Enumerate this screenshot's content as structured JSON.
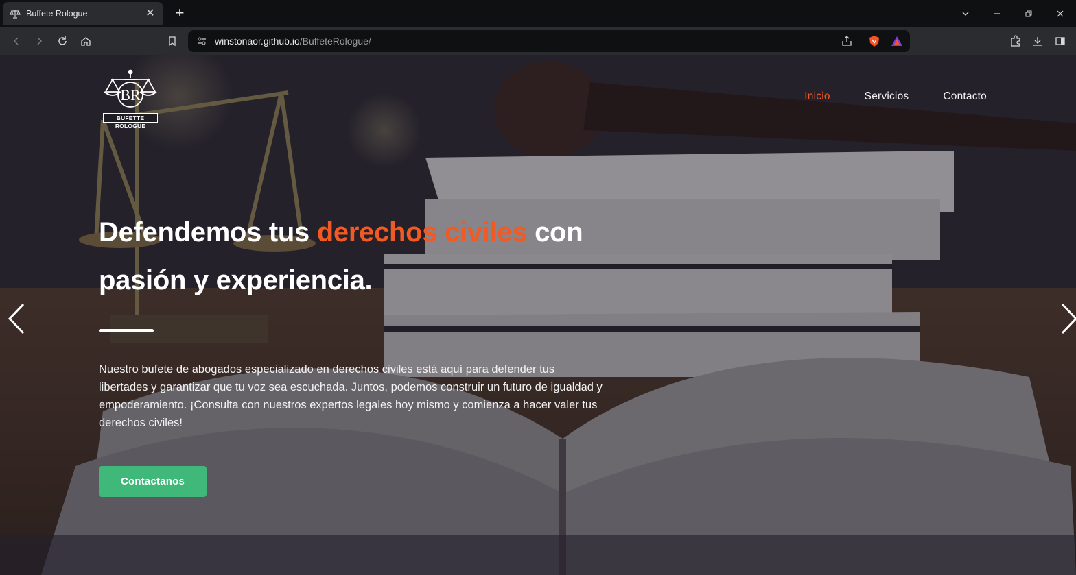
{
  "browser": {
    "tab_title": "Buffete Rologue",
    "address_host": "winstonaor.github.io",
    "address_path": "/BuffeteRologue/"
  },
  "site": {
    "logo_text": "BUFETTE ROLOGUE",
    "logo_monogram": "BR",
    "nav": [
      {
        "label": "Inicio",
        "active": true
      },
      {
        "label": "Servicios",
        "active": false
      },
      {
        "label": "Contacto",
        "active": false
      }
    ],
    "headline": {
      "part1": "Defendemos tus ",
      "highlight": "derechos civiles",
      "part2": " con pasión y experiencia."
    },
    "lead": "Nuestro bufete de abogados especializado en derechos civiles está aquí para defender tus libertades y garantizar que tu voz sea escuchada. Juntos, podemos construir un futuro de igualdad y empoderamiento. ¡Consulta con nuestros expertos legales hoy mismo y comienza a hacer valer tus derechos civiles!",
    "cta_label": "Contactanos"
  },
  "colors": {
    "accent": "#f25a24",
    "nav_active": "#ef5a2a",
    "cta": "#3fb87a"
  },
  "icons": [
    "back-icon",
    "forward-icon",
    "reload-icon",
    "home-icon",
    "bookmark-icon",
    "site-info-icon",
    "share-icon",
    "brave-shield-icon",
    "brave-rewards-icon",
    "extensions-icon",
    "downloads-icon",
    "sidebar-icon",
    "chevron-left-icon",
    "chevron-right-icon"
  ]
}
